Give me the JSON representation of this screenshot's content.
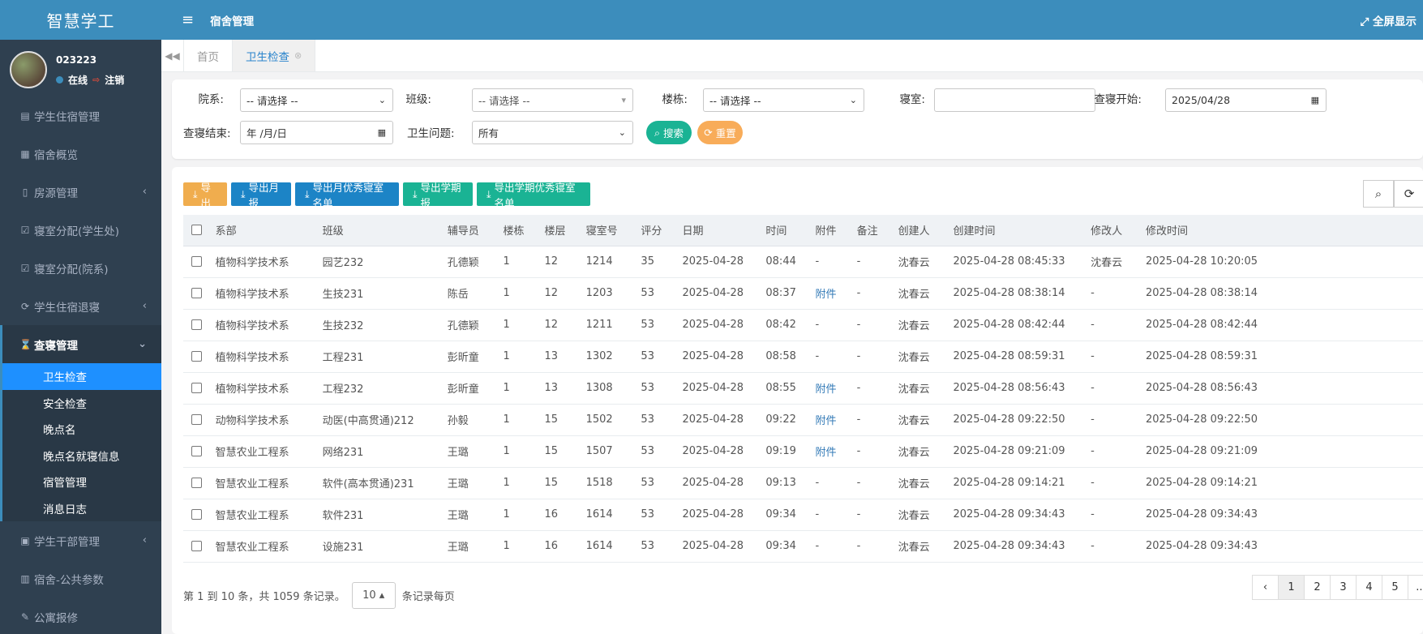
{
  "app": {
    "brand": "智慧学工"
  },
  "user": {
    "name": "023223",
    "online": "在线",
    "logout": "注销"
  },
  "sidebar": {
    "items": [
      {
        "label": "学生住宿管理",
        "icon": "list-icon"
      },
      {
        "label": "宿舍概览",
        "icon": "map-icon"
      },
      {
        "label": "房源管理",
        "icon": "building-icon"
      },
      {
        "label": "寝室分配(学生处)",
        "icon": "check-square-icon"
      },
      {
        "label": "寝室分配(院系)",
        "icon": "check-square-icon"
      },
      {
        "label": "学生住宿退寝",
        "icon": "refresh-icon"
      },
      {
        "label": "查寝管理",
        "icon": "hourglass-icon"
      }
    ],
    "sub_items": [
      "卫生检查",
      "安全检查",
      "晚点名",
      "晚点名就寝信息",
      "宿管管理",
      "消息日志"
    ],
    "bottom_items": [
      {
        "label": "学生干部管理",
        "icon": "id-card-icon"
      },
      {
        "label": "宿舍-公共参数",
        "icon": "book-icon"
      },
      {
        "label": "公寓报修",
        "icon": "wrench-icon"
      }
    ]
  },
  "topbar": {
    "title": "宿舍管理",
    "fullscreen": "全屏显示"
  },
  "tabs": {
    "home": "首页",
    "current": "卫生检查"
  },
  "search": {
    "dept_label": "院系:",
    "dept_value": "-- 请选择 --",
    "class_label": "班级:",
    "class_value": "-- 请选择 --",
    "building_label": "楼栋:",
    "building_value": "-- 请选择 --",
    "room_label": "寝室:",
    "room_value": "",
    "start_label": "查寝开始:",
    "start_value": "2025/04/28",
    "end_label": "查寝结束:",
    "end_value": "年 /月/日",
    "issue_label": "卫生问题:",
    "issue_value": "所有",
    "search_btn": "搜索",
    "reset_btn": "重置"
  },
  "toolbar": {
    "export": "导出",
    "export_month": "导出月报",
    "export_month_excellent": "导出月优秀寝室名单",
    "export_term": "导出学期报",
    "export_term_excellent": "导出学期优秀寝室名单"
  },
  "table": {
    "headers": [
      "系部",
      "班级",
      "辅导员",
      "楼栋",
      "楼层",
      "寝室号",
      "评分",
      "日期",
      "时间",
      "附件",
      "备注",
      "创建人",
      "创建时间",
      "修改人",
      "修改时间"
    ],
    "rows": [
      [
        "植物科学技术系",
        "园艺232",
        "孔德颖",
        "1",
        "12",
        "1214",
        "35",
        "2025-04-28",
        "08:44",
        "-",
        "-",
        "沈春云",
        "2025-04-28 08:45:33",
        "沈春云",
        "2025-04-28 10:20:05"
      ],
      [
        "植物科学技术系",
        "生技231",
        "陈岳",
        "1",
        "12",
        "1203",
        "53",
        "2025-04-28",
        "08:37",
        "附件",
        "-",
        "沈春云",
        "2025-04-28 08:38:14",
        "-",
        "2025-04-28 08:38:14"
      ],
      [
        "植物科学技术系",
        "生技232",
        "孔德颖",
        "1",
        "12",
        "1211",
        "53",
        "2025-04-28",
        "08:42",
        "-",
        "-",
        "沈春云",
        "2025-04-28 08:42:44",
        "-",
        "2025-04-28 08:42:44"
      ],
      [
        "植物科学技术系",
        "工程231",
        "彭昕童",
        "1",
        "13",
        "1302",
        "53",
        "2025-04-28",
        "08:58",
        "-",
        "-",
        "沈春云",
        "2025-04-28 08:59:31",
        "-",
        "2025-04-28 08:59:31"
      ],
      [
        "植物科学技术系",
        "工程232",
        "彭昕童",
        "1",
        "13",
        "1308",
        "53",
        "2025-04-28",
        "08:55",
        "附件",
        "-",
        "沈春云",
        "2025-04-28 08:56:43",
        "-",
        "2025-04-28 08:56:43"
      ],
      [
        "动物科学技术系",
        "动医(中高贯通)212",
        "孙毅",
        "1",
        "15",
        "1502",
        "53",
        "2025-04-28",
        "09:22",
        "附件",
        "-",
        "沈春云",
        "2025-04-28 09:22:50",
        "-",
        "2025-04-28 09:22:50"
      ],
      [
        "智慧农业工程系",
        "网络231",
        "王璐",
        "1",
        "15",
        "1507",
        "53",
        "2025-04-28",
        "09:19",
        "附件",
        "-",
        "沈春云",
        "2025-04-28 09:21:09",
        "-",
        "2025-04-28 09:21:09"
      ],
      [
        "智慧农业工程系",
        "软件(高本贯通)231",
        "王璐",
        "1",
        "15",
        "1518",
        "53",
        "2025-04-28",
        "09:13",
        "-",
        "-",
        "沈春云",
        "2025-04-28 09:14:21",
        "-",
        "2025-04-28 09:14:21"
      ],
      [
        "智慧农业工程系",
        "软件231",
        "王璐",
        "1",
        "16",
        "1614",
        "53",
        "2025-04-28",
        "09:34",
        "-",
        "-",
        "沈春云",
        "2025-04-28 09:34:43",
        "-",
        "2025-04-28 09:34:43"
      ],
      [
        "智慧农业工程系",
        "设施231",
        "王璐",
        "1",
        "16",
        "1614",
        "53",
        "2025-04-28",
        "09:34",
        "-",
        "-",
        "沈春云",
        "2025-04-28 09:34:43",
        "-",
        "2025-04-28 09:34:43"
      ]
    ]
  },
  "pager": {
    "info": "第 1 到 10 条，共 1059 条记录。",
    "page_size": "10",
    "per_page": "条记录每页",
    "prev": "‹",
    "pages": [
      "1",
      "2",
      "3",
      "4",
      "5"
    ],
    "ellipsis": "..."
  },
  "colors": {
    "topbar": "#3c8dbc",
    "sidebar": "#2f4050",
    "active_sub": "#1e90ff",
    "orange": "#f0ad4e",
    "blue": "#1c84c6",
    "teal": "#1ab394",
    "search_btn": "#1ab394",
    "reset_btn": "#f8ac59"
  }
}
